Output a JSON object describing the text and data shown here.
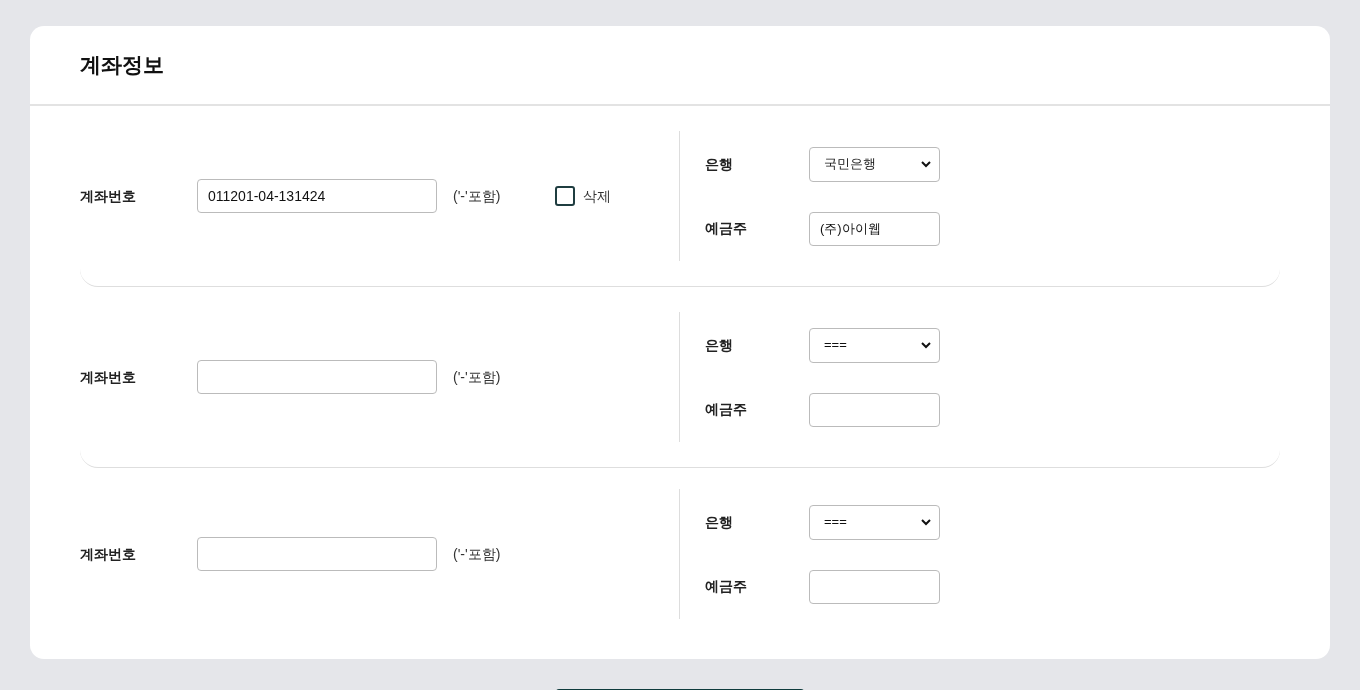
{
  "title": "계좌정보",
  "accounts": [
    {
      "account_label": "계좌번호",
      "account_number": "011201-04-131424",
      "hint": "('-'포함)",
      "delete": {
        "label": "삭제",
        "checked": false
      },
      "bank_label": "은행",
      "bank": "국민은행",
      "holder_label": "예금주",
      "holder": "(주)아이웹"
    },
    {
      "account_label": "계좌번호",
      "hint": "('-'포함)",
      "bank_label": "은행",
      "bank": "===",
      "holder_label": "예금주"
    },
    {
      "account_label": "계좌번호",
      "hint": "('-'포함)",
      "bank_label": "은행",
      "bank": "===",
      "holder_label": "예금주"
    }
  ]
}
